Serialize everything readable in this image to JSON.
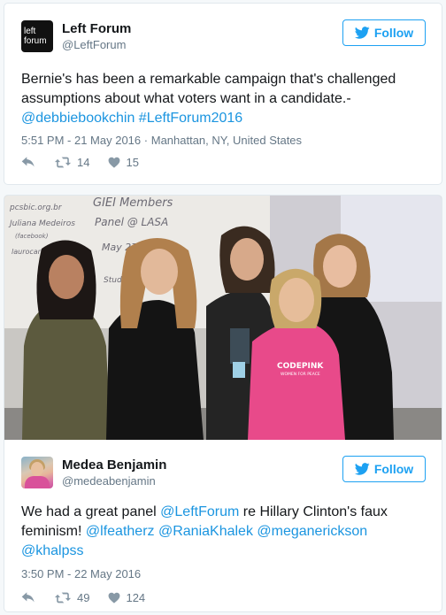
{
  "tweet1": {
    "display_name": "Left Forum",
    "handle": "@LeftForum",
    "avatar_line1": "left",
    "avatar_line2": "forum",
    "follow_label": "Follow",
    "text_plain": "Bernie's has been a remarkable campaign that's challenged assumptions about what voters want in a candidate.-",
    "link_mention": "@debbiebookchin",
    "link_hashtag": "#LeftForum2016",
    "timestamp": "5:51 PM - 21 May 2016",
    "separator": "·",
    "location": "Manhattan, NY, United States",
    "retweets": "14",
    "likes": "15"
  },
  "tweet2": {
    "photo_whiteboard_text": [
      "pcsbic.org.br",
      "GIEI Members",
      "Juliana Medeiros",
      "(facebook)",
      "Panel @ LASA",
      "laurocampos.org",
      "May 27th",
      "Studio B"
    ],
    "photo_shirt_text": "CODEPINK",
    "photo_shirt_subtext": "WOMEN FOR PEACE",
    "display_name": "Medea Benjamin",
    "handle": "@medeabenjamin",
    "follow_label": "Follow",
    "text_part1": "We had a great panel",
    "link_leftforum": "@LeftForum",
    "text_part2": "re Hillary Clinton's faux feminism!",
    "link_lfeatherz": "@lfeatherz",
    "link_raniakhalek": "@RaniaKhalek",
    "link_meganerickson": "@meganerickson",
    "link_khalpss": "@khalpss",
    "timestamp": "3:50 PM - 22 May 2016",
    "retweets": "49",
    "likes": "124"
  },
  "colors": {
    "accent": "#1da1f2",
    "link": "#1b95e0",
    "muted": "#657786",
    "shirt_pink": "#e84a8a"
  }
}
